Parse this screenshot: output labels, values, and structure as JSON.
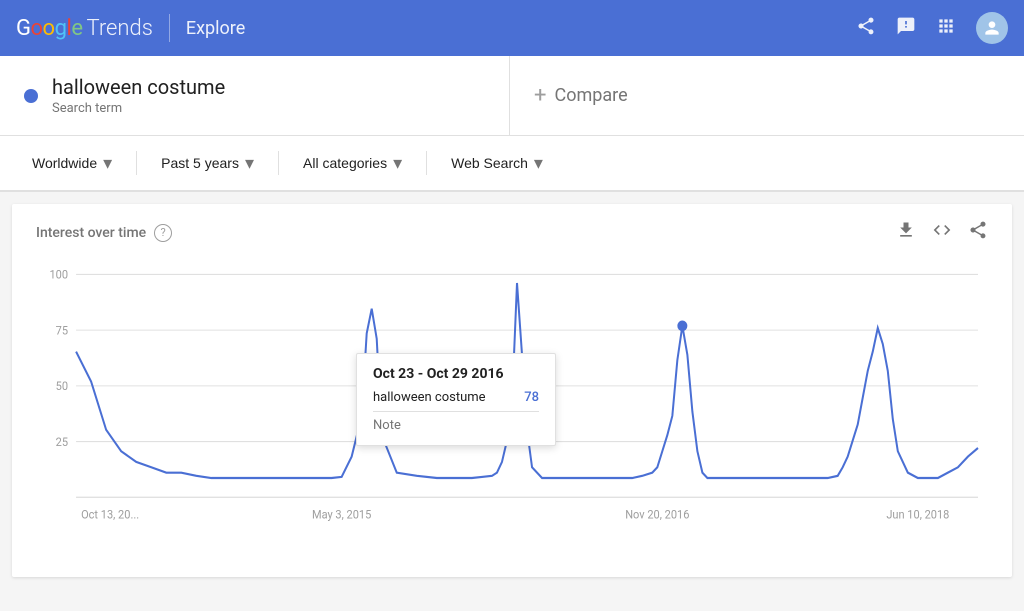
{
  "header": {
    "google_label": "Google",
    "trends_label": "Trends",
    "explore_label": "Explore",
    "share_icon": "share",
    "feedback_icon": "feedback",
    "apps_icon": "apps",
    "account_icon": "account"
  },
  "search": {
    "term": "halloween costume",
    "term_type": "Search term",
    "compare_label": "Compare",
    "dot_color": "#4a6fd4"
  },
  "filters": {
    "location": "Worldwide",
    "time_range": "Past 5 years",
    "category": "All categories",
    "search_type": "Web Search"
  },
  "chart": {
    "title": "Interest over time",
    "help_label": "?",
    "download_icon": "download",
    "embed_icon": "embed",
    "share_icon": "share",
    "x_labels": [
      "Oct 13, 20...",
      "May 3, 2015",
      "Nov 20, 2016",
      "Jun 10, 2018"
    ],
    "y_labels": [
      "100",
      "75",
      "50",
      "25"
    ],
    "color": "#4a6fd4",
    "grid_color": "#e0e0e0"
  },
  "tooltip": {
    "date": "Oct 23 - Oct 29 2016",
    "term": "halloween costume",
    "value": "78",
    "note_label": "Note"
  }
}
